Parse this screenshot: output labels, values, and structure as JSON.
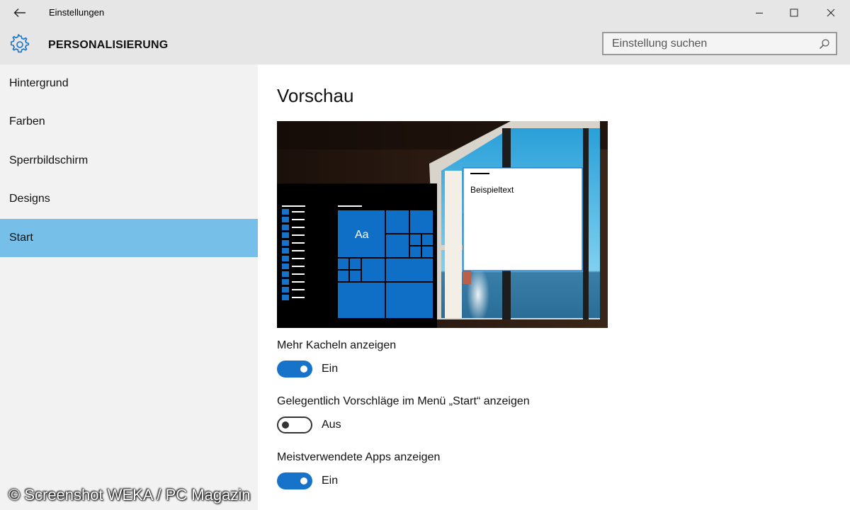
{
  "window": {
    "title": "Einstellungen",
    "controls": [
      "minimize",
      "maximize",
      "close"
    ]
  },
  "header": {
    "section_title": "PERSONALISIERUNG",
    "icon": "gear-icon",
    "search_placeholder": "Einstellung suchen"
  },
  "sidebar": {
    "items": [
      {
        "label": "Hintergrund",
        "active": false
      },
      {
        "label": "Farben",
        "active": false
      },
      {
        "label": "Sperrbildschirm",
        "active": false
      },
      {
        "label": "Designs",
        "active": false
      },
      {
        "label": "Start",
        "active": true
      }
    ],
    "active_color": "#76bfe9"
  },
  "main": {
    "preview_title": "Vorschau",
    "preview": {
      "tile_label": "Aa",
      "window_text": "Beispieltext",
      "accent_color": "#0f6fc6"
    },
    "settings": [
      {
        "label": "Mehr Kacheln anzeigen",
        "state": "Ein",
        "on": true
      },
      {
        "label": "Gelegentlich Vorschläge im Menü „Start“ anzeigen",
        "state": "Aus",
        "on": false
      },
      {
        "label": "Meistverwendete Apps anzeigen",
        "state": "Ein",
        "on": true
      }
    ]
  },
  "watermark": "© Screenshot WEKA / PC Magazin"
}
